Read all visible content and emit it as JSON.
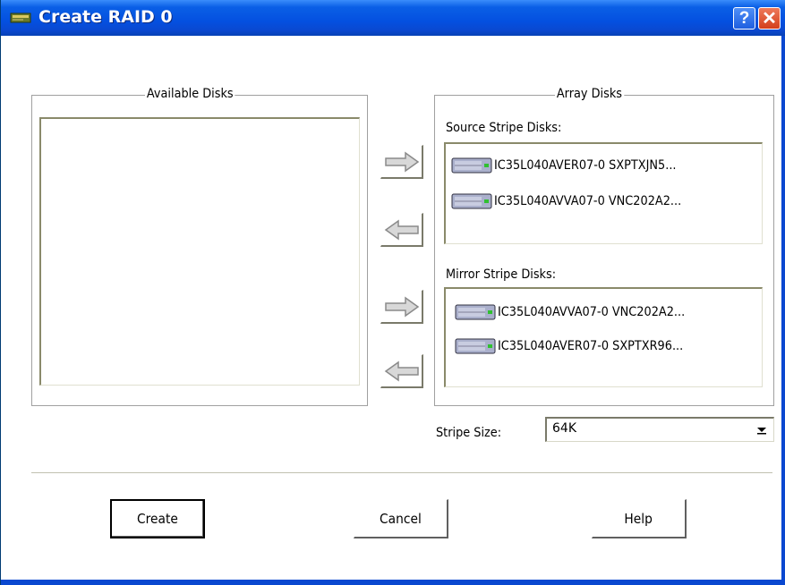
{
  "window": {
    "title": "Create RAID 0",
    "help_label": "?",
    "close_label": "✕"
  },
  "available": {
    "label": "Available Disks",
    "items": []
  },
  "array": {
    "label": "Array Disks",
    "source_label": "Source Stripe Disks:",
    "source_disks": [
      "IC35L040AVER07-0 SXPTXJN5...",
      "IC35L040AVVA07-0 VNC202A2..."
    ],
    "mirror_label": "Mirror Stripe Disks:",
    "mirror_disks": [
      "IC35L040AVVA07-0 VNC202A2...",
      "IC35L040AVER07-0 SXPTXR96..."
    ]
  },
  "stripe": {
    "label": "Stripe Size:",
    "value": "64K"
  },
  "buttons": {
    "create": "Create",
    "cancel": "Cancel",
    "help": "Help"
  },
  "icons": {
    "disk": "hard-disk-icon",
    "add": "right-arrow-icon",
    "remove": "left-arrow-icon"
  }
}
